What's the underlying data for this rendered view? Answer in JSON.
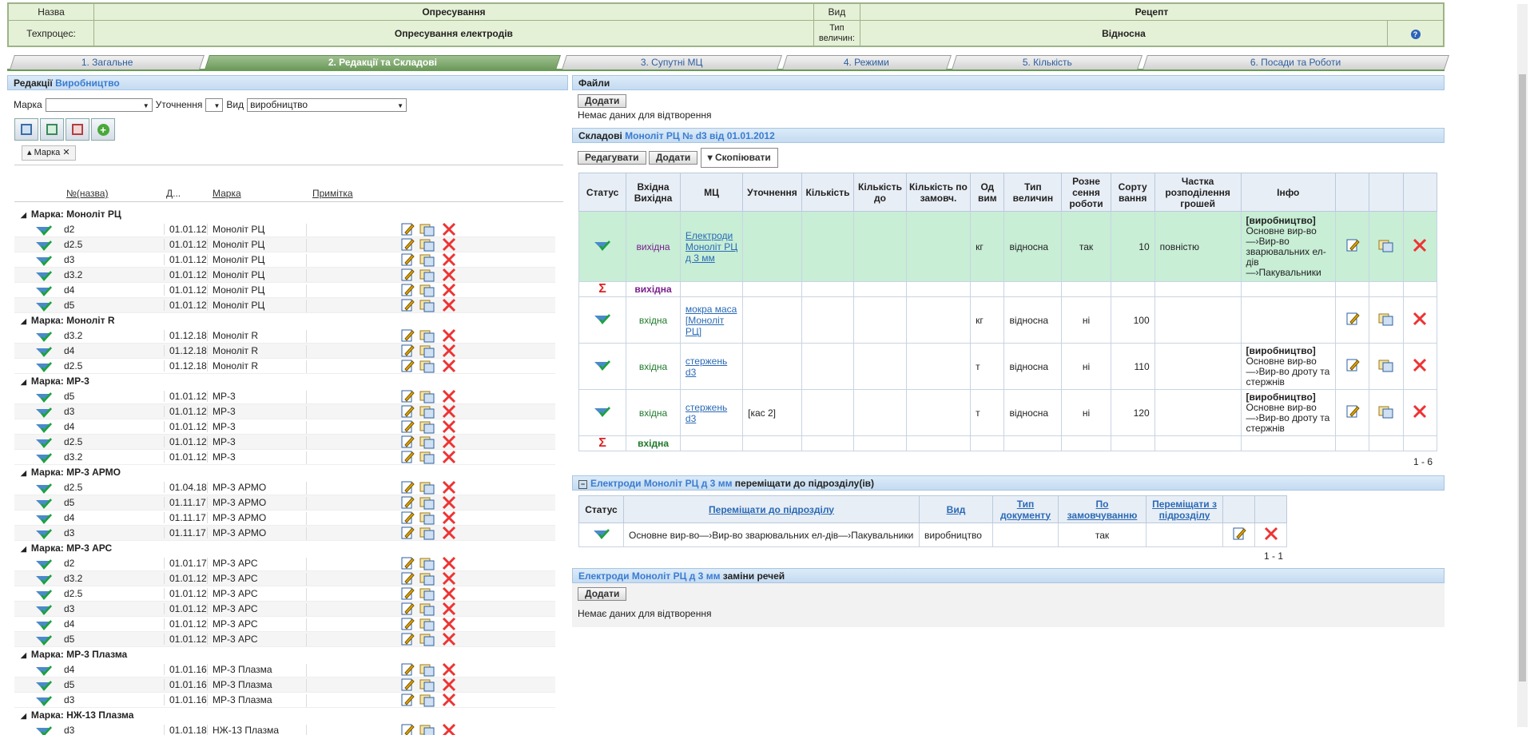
{
  "header": {
    "name_label": "Назва",
    "name_value": "Опресування",
    "vid_label": "Вид",
    "vid_value": "Рецепт",
    "techprocess_label": "Техпроцес:",
    "techprocess_value": "Опресування електродів",
    "value_type_label": "Тип величин:",
    "value_type_value": "Відносна"
  },
  "tabs": [
    "1. Загальне",
    "2. Редакції та Складові",
    "3. Супутні МЦ",
    "4. Режими",
    "5. Кількість",
    "6. Посади та Роботи"
  ],
  "left": {
    "title_prefix": "Редакції",
    "title_value": "Виробництво",
    "filter_marka_label": "Марка",
    "filter_marka_value": "",
    "filter_utochn_label": "Уточнення",
    "filter_utochn_value": "",
    "filter_vid_label": "Вид",
    "filter_vid_value": "виробництво",
    "chip_label": "Марка",
    "columns": [
      "№(назва)",
      "Д...",
      "Марка",
      "Примітка"
    ],
    "groups": [
      {
        "title": "Марка: Моноліт РЦ",
        "rows": [
          [
            "d2",
            "01.01.12",
            "Моноліт РЦ"
          ],
          [
            "d2.5",
            "01.01.12",
            "Моноліт РЦ"
          ],
          [
            "d3",
            "01.01.12",
            "Моноліт РЦ"
          ],
          [
            "d3.2",
            "01.01.12",
            "Моноліт РЦ"
          ],
          [
            "d4",
            "01.01.12",
            "Моноліт РЦ"
          ],
          [
            "d5",
            "01.01.12",
            "Моноліт РЦ"
          ]
        ]
      },
      {
        "title": "Марка: Моноліт R",
        "rows": [
          [
            "d3.2",
            "01.12.18",
            "Моноліт R"
          ],
          [
            "d4",
            "01.12.18",
            "Моноліт R"
          ],
          [
            "d2.5",
            "01.12.18",
            "Моноліт R"
          ]
        ]
      },
      {
        "title": "Марка: МР-3",
        "rows": [
          [
            "d5",
            "01.01.12",
            "МР-3"
          ],
          [
            "d3",
            "01.01.12",
            "МР-3"
          ],
          [
            "d4",
            "01.01.12",
            "МР-3"
          ],
          [
            "d2.5",
            "01.01.12",
            "МР-3"
          ],
          [
            "d3.2",
            "01.01.12",
            "МР-3"
          ]
        ]
      },
      {
        "title": "Марка: МР-3 АРМО",
        "rows": [
          [
            "d2.5",
            "01.04.18",
            "МР-3 АРМО"
          ],
          [
            "d5",
            "01.11.17",
            "МР-3 АРМО"
          ],
          [
            "d4",
            "01.11.17",
            "МР-3 АРМО"
          ],
          [
            "d3",
            "01.11.17",
            "МР-3 АРМО"
          ]
        ]
      },
      {
        "title": "Марка: МР-3 АРС",
        "rows": [
          [
            "d2",
            "01.01.17",
            "МР-3 АРС"
          ],
          [
            "d3.2",
            "01.01.12",
            "МР-3 АРС"
          ],
          [
            "d2.5",
            "01.01.12",
            "МР-3 АРС"
          ],
          [
            "d3",
            "01.01.12",
            "МР-3 АРС"
          ],
          [
            "d4",
            "01.01.12",
            "МР-3 АРС"
          ],
          [
            "d5",
            "01.01.12",
            "МР-3 АРС"
          ]
        ]
      },
      {
        "title": "Марка: МР-3 Плазма",
        "rows": [
          [
            "d4",
            "01.01.16",
            "МР-3 Плазма"
          ],
          [
            "d5",
            "01.01.16",
            "МР-3 Плазма"
          ],
          [
            "d3",
            "01.01.16",
            "МР-3 Плазма"
          ]
        ]
      },
      {
        "title": "Марка: НЖ-13 Плазма",
        "rows": [
          [
            "d3",
            "01.01.18",
            "НЖ-13 Плазма"
          ]
        ]
      }
    ]
  },
  "files": {
    "title": "Файли",
    "add": "Додати",
    "empty": "Немає даних для відтворення"
  },
  "comp": {
    "title_prefix": "Складові",
    "title_value": "Моноліт РЦ № d3 від 01.01.2012",
    "edit": "Редагувати",
    "add": "Додати",
    "copy": "Скопіювати",
    "headers": [
      "Статус",
      "Вхідна Вихідна",
      "МЦ",
      "Уточнення",
      "Кількість",
      "Кількість до",
      "Кількість по замовч.",
      "Од вим",
      "Тип величин",
      "Розне сення роботи",
      "Сорту вання",
      "Частка розподілення грошей",
      "Інфо"
    ],
    "rows": [
      {
        "io": "вихідна",
        "mc": "Електроди Моноліт РЦ д 3 мм",
        "ut": "",
        "unit": "кг",
        "type": "відносна",
        "rozn": "так",
        "sort": "10",
        "chast": "повністю",
        "info_b": "[виробництво]",
        "info": "Основне вир-во —›Вир-во зварювальних ел-дів —›Пакувальники"
      },
      {
        "io": "вхідна",
        "mc": "мокра маса [Моноліт РЦ]",
        "ut": "",
        "unit": "кг",
        "type": "відносна",
        "rozn": "ні",
        "sort": "100",
        "chast": "",
        "info_b": "",
        "info": ""
      },
      {
        "io": "вхідна",
        "mc": "стержень d3",
        "ut": "",
        "unit": "т",
        "type": "відносна",
        "rozn": "ні",
        "sort": "110",
        "chast": "",
        "info_b": "[виробництво]",
        "info": "Основне вир-во —›Вир-во дроту та стержнів"
      },
      {
        "io": "вхідна",
        "mc": "стержень d3",
        "ut": "[кас 2]",
        "unit": "т",
        "type": "відносна",
        "rozn": "ні",
        "sort": "120",
        "chast": "",
        "info_b": "[виробництво]",
        "info": "Основне вир-во —›Вир-во дроту та стержнів"
      }
    ],
    "sum_out": "вихідна",
    "sum_in": "вхідна",
    "pager": "1 - 6"
  },
  "move": {
    "title_value": "Електроди Моноліт РЦ д 3 мм",
    "title_suffix": "переміщати до підрозділу(ів)",
    "headers": [
      "Статус",
      "Переміщати до підрозділу",
      "Вид",
      "Тип документу",
      "По замовчуванню",
      "Переміщати з підрозділу"
    ],
    "row": [
      "Основне вир-во—›Вир-во зварювальних ел-дів—›Пакувальники",
      "виробництво",
      "",
      "так",
      ""
    ],
    "pager": "1 - 1"
  },
  "repl": {
    "title_value": "Електроди Моноліт РЦ д 3 мм",
    "title_suffix": "заміни речей",
    "add": "Додати",
    "empty": "Немає даних для відтворення"
  }
}
